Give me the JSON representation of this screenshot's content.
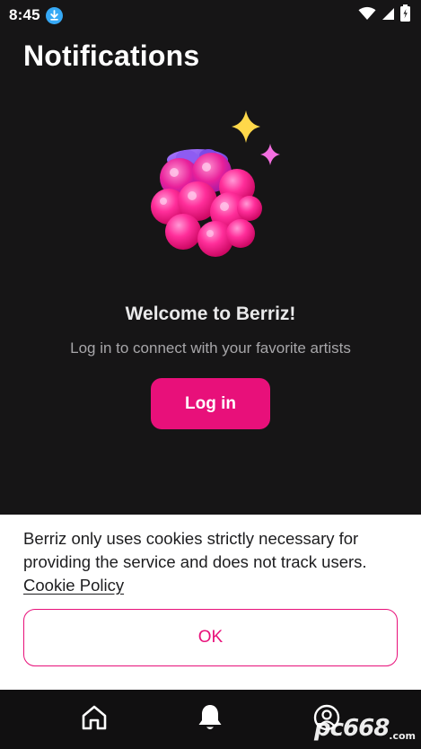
{
  "status_bar": {
    "time": "8:45",
    "icons": [
      "download-icon",
      "wifi-icon",
      "signal-icon",
      "battery-icon"
    ]
  },
  "header": {
    "title": "Notifications"
  },
  "hero": {
    "image": "raspberry-illustration",
    "title": "Welcome to Berriz!",
    "subtitle": "Log in to connect with your favorite artists",
    "login_label": "Log in"
  },
  "cookie_banner": {
    "text": "Berriz only uses cookies strictly necessary for providing the service and does not track users.",
    "link_label": "Cookie Policy",
    "ok_label": "OK"
  },
  "bottom_nav": {
    "items": [
      {
        "icon": "home-icon"
      },
      {
        "icon": "bell-icon",
        "active": true
      },
      {
        "icon": "profile-icon"
      }
    ]
  },
  "watermark": {
    "text": "pc668",
    "suffix": ".com"
  },
  "colors": {
    "accent": "#e8107a",
    "background": "#161516",
    "sheet": "#ffffff"
  }
}
